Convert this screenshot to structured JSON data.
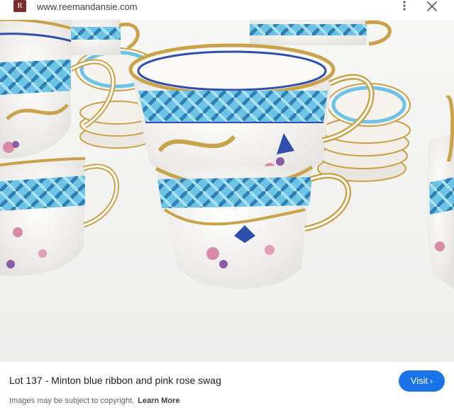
{
  "header": {
    "favicon_letter": "R",
    "url": "www.reemandansie.com",
    "more_icon": "more-vert-icon",
    "close_icon": "close-icon"
  },
  "image": {
    "subject": "product-photo",
    "colors": {
      "ribbon": "#58b6da",
      "gilt": "#c9a24a",
      "rim": "#2f4fae"
    }
  },
  "caption": {
    "title": "Lot 137 - Minton blue ribbon and pink rose swag",
    "visit_label": "Visit",
    "visit_icon": "chevron-right-icon",
    "copyright_text": "Images may be subject to copyright.",
    "learn_more": "Learn More"
  },
  "colors": {
    "accent": "#1a73e8",
    "text": "#202124",
    "muted": "#5f6368"
  }
}
